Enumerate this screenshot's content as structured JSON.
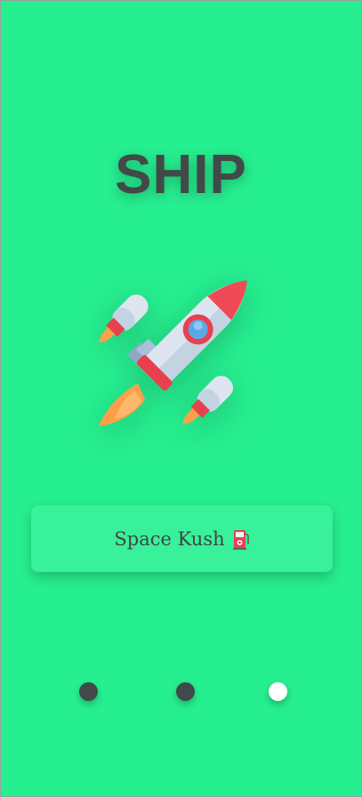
{
  "screen": {
    "title": "SHIP",
    "illustration": "rocket-icon"
  },
  "card": {
    "label": "Space Kush",
    "icon": "fuel-pump-icon"
  },
  "pagination": {
    "pages": 3,
    "active_index": 2,
    "active_color": "#ffffff",
    "inactive_color": "#424949"
  },
  "colors": {
    "background": "#26ef90",
    "card": "#38f19a",
    "text": "#424949"
  }
}
